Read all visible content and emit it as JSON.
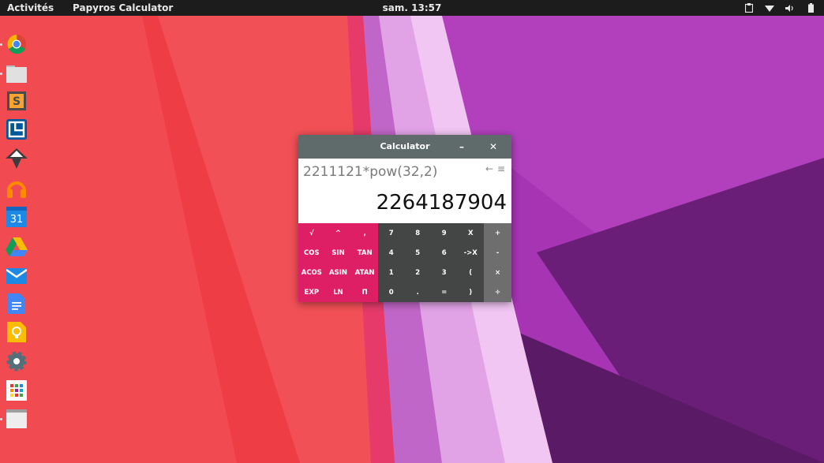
{
  "topbar": {
    "activities_label": "Activités",
    "app_name": "Papyros Calculator",
    "clock": "sam. 13:57",
    "tray_icons": [
      "clipboard-icon",
      "wifi-icon",
      "volume-icon",
      "battery-icon"
    ]
  },
  "dock": {
    "apps": [
      {
        "name": "chrome-icon",
        "running": true
      },
      {
        "name": "files-icon",
        "running": true
      },
      {
        "name": "sublime-text-icon",
        "running": false
      },
      {
        "name": "window-manager-icon",
        "running": false
      },
      {
        "name": "inkscape-icon",
        "running": false
      },
      {
        "name": "music-headphones-icon",
        "running": false
      },
      {
        "name": "calendar-icon",
        "running": false,
        "text": "31"
      },
      {
        "name": "google-drive-icon",
        "running": false
      },
      {
        "name": "mail-icon",
        "running": false
      },
      {
        "name": "docs-icon",
        "running": false
      },
      {
        "name": "keep-lightbulb-icon",
        "running": false
      },
      {
        "name": "settings-gear-icon",
        "running": false
      },
      {
        "name": "app-grid-icon",
        "running": false
      },
      {
        "name": "window-icon",
        "running": true
      }
    ]
  },
  "calculator": {
    "title": "Calculator",
    "minimize_label": "–",
    "close_label": "✕",
    "expression": "2211121*pow(32,2)",
    "result": "2264187904",
    "backspace_icon": "←",
    "menu_icon": "≡",
    "function_keys": [
      "√",
      "^",
      ",",
      "COS",
      "SIN",
      "TAN",
      "ACOS",
      "ASIN",
      "ATAN",
      "EXP",
      "LN",
      "Π"
    ],
    "number_keys": [
      "7",
      "8",
      "9",
      "X",
      "4",
      "5",
      "6",
      "->X",
      "1",
      "2",
      "3",
      "(",
      "0",
      ".",
      "=",
      ")"
    ],
    "operator_keys": [
      "+",
      "-",
      "×",
      "÷"
    ]
  },
  "colors": {
    "topbar_bg": "#1c1c1c",
    "wallpaper_red": "#f0454c",
    "wallpaper_purple": "#a634b3",
    "calc_titlebar": "#5f6b6b",
    "calc_fn_pad": "#de1f66",
    "calc_num_pad": "#444545",
    "calc_op_pad": "#6e6e6e"
  }
}
